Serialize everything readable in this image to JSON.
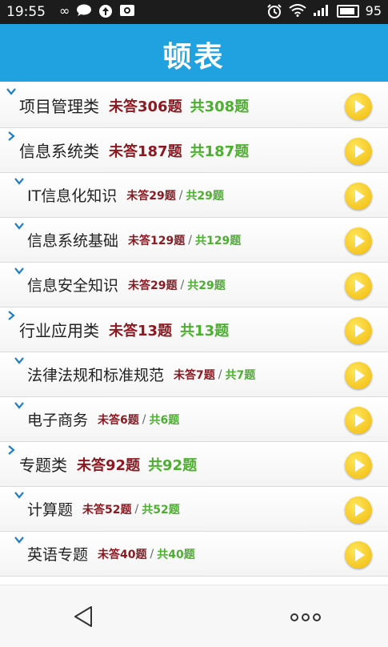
{
  "status_bar": {
    "time": "19:55",
    "battery": "95",
    "icons": [
      "infinity-icon",
      "chat-icon",
      "upload-icon",
      "image-icon",
      "alarm-icon",
      "wifi-icon",
      "signal-icon",
      "battery-icon"
    ]
  },
  "header": {
    "title": "顿表"
  },
  "sep": "/",
  "items": [
    {
      "name": "项目管理类",
      "answered": "未答306题",
      "total": "共308题",
      "level": "top",
      "expanded": true
    },
    {
      "name": "信息系统类",
      "answered": "未答187题",
      "total": "共187题",
      "level": "top",
      "expanded": false
    },
    {
      "name": "IT信息化知识",
      "answered": "未答29题",
      "total": "共29题",
      "level": "sub",
      "expanded": true
    },
    {
      "name": "信息系统基础",
      "answered": "未答129题",
      "total": "共129题",
      "level": "sub",
      "expanded": true
    },
    {
      "name": "信息安全知识",
      "answered": "未答29题",
      "total": "共29题",
      "level": "sub",
      "expanded": true
    },
    {
      "name": "行业应用类",
      "answered": "未答13题",
      "total": "共13题",
      "level": "top",
      "expanded": false
    },
    {
      "name": "法律法规和标准规范",
      "answered": "未答7题",
      "total": "共7题",
      "level": "sub",
      "expanded": true
    },
    {
      "name": "电子商务",
      "answered": "未答6题",
      "total": "共6题",
      "level": "sub",
      "expanded": true
    },
    {
      "name": "专题类",
      "answered": "未答92题",
      "total": "共92题",
      "level": "top",
      "expanded": false
    },
    {
      "name": "计算题",
      "answered": "未答52题",
      "total": "共52题",
      "level": "sub",
      "expanded": true
    },
    {
      "name": "英语专题",
      "answered": "未答40题",
      "total": "共40题",
      "level": "sub",
      "expanded": true
    }
  ],
  "colors": {
    "accent": "#21a2e0",
    "answered": "#8b1a22",
    "total": "#4caf2f",
    "play": "#f5c518"
  },
  "nav": {
    "back_icon": "back-triangle-icon",
    "more_icon": "more-dots-icon"
  }
}
